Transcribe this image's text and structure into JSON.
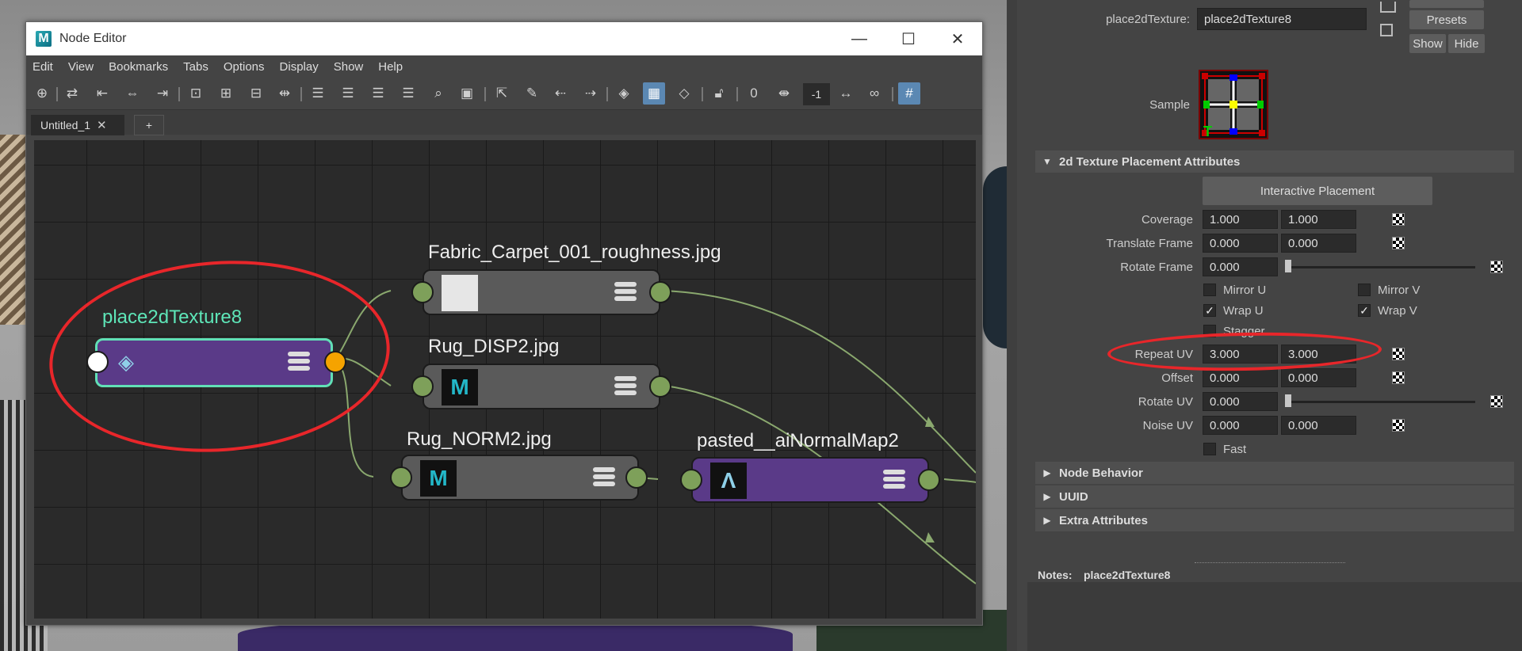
{
  "node_editor": {
    "title": "Node Editor",
    "menus": [
      "Edit",
      "View",
      "Bookmarks",
      "Tabs",
      "Options",
      "Display",
      "Show",
      "Help"
    ],
    "toolbar_number": "-1",
    "toolbar_zero": "0",
    "tab": {
      "label": "Untitled_1",
      "close": "✕",
      "add": "+"
    },
    "nodes": {
      "place2d": {
        "title": "place2dTexture8"
      },
      "fabric": {
        "title": "Fabric_Carpet_001_roughness.jpg"
      },
      "rug_disp": {
        "title": "Rug_DISP2.jpg",
        "thumb": "M"
      },
      "rug_norm": {
        "title": "Rug_NORM2.jpg",
        "thumb": "M"
      },
      "normal_map": {
        "title": "pasted__aiNormalMap2",
        "thumb": "Λ"
      }
    }
  },
  "attr_editor": {
    "node_label": "place2dTexture:",
    "node_value": "place2dTexture8",
    "presets": "Presets",
    "show": "Show",
    "hide": "Hide",
    "sample_label": "Sample",
    "section_main": "2d Texture Placement Attributes",
    "interactive_placement": "Interactive Placement",
    "rows": {
      "coverage": {
        "label": "Coverage",
        "v1": "1.000",
        "v2": "1.000"
      },
      "translate_frame": {
        "label": "Translate Frame",
        "v1": "0.000",
        "v2": "0.000"
      },
      "rotate_frame": {
        "label": "Rotate Frame",
        "v1": "0.000"
      },
      "repeat_uv": {
        "label": "Repeat UV",
        "v1": "3.000",
        "v2": "3.000"
      },
      "offset": {
        "label": "Offset",
        "v1": "0.000",
        "v2": "0.000"
      },
      "rotate_uv": {
        "label": "Rotate UV",
        "v1": "0.000"
      },
      "noise_uv": {
        "label": "Noise UV",
        "v1": "0.000",
        "v2": "0.000"
      }
    },
    "checks": {
      "mirror_u": "Mirror U",
      "mirror_v": "Mirror V",
      "wrap_u": "Wrap U",
      "wrap_v": "Wrap V",
      "stagger": "Stagger",
      "fast": "Fast"
    },
    "sections": [
      "Node Behavior",
      "UUID",
      "Extra Attributes"
    ],
    "notes_label": "Notes:",
    "notes_value": "place2dTexture8"
  }
}
